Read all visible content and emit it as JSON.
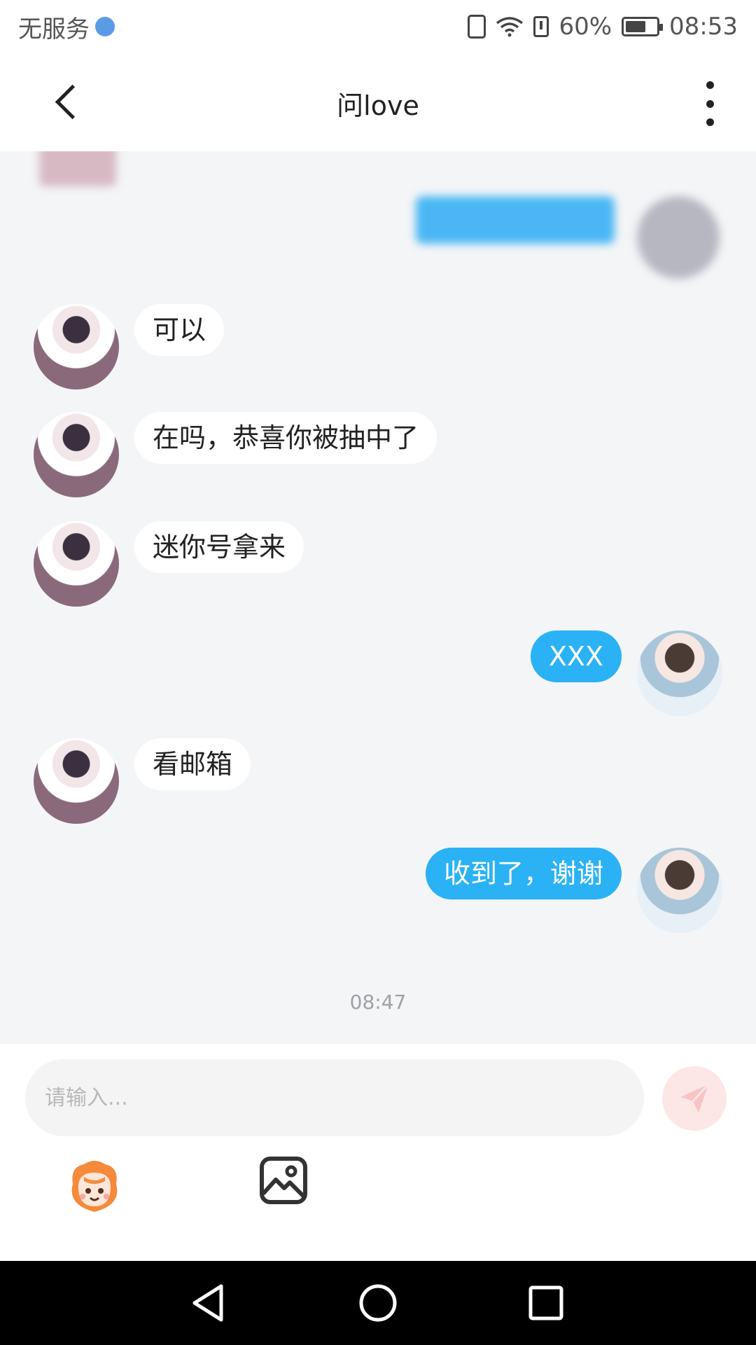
{
  "status_bar": {
    "carrier": "无服务",
    "battery": "60%",
    "time": "08:53"
  },
  "header": {
    "title": "问love"
  },
  "messages": [
    {
      "side": "in",
      "text": "可以"
    },
    {
      "side": "in",
      "text": "在吗，恭喜你被抽中了"
    },
    {
      "side": "in",
      "text": "迷你号拿来"
    },
    {
      "side": "out",
      "text": "XXX"
    },
    {
      "side": "in",
      "text": "看邮箱"
    },
    {
      "side": "out",
      "text": "收到了，谢谢"
    }
  ],
  "timestamp": "08:47",
  "input": {
    "placeholder": "请输入..."
  },
  "colors": {
    "outgoing_bubble": "#2ab2f5",
    "incoming_bubble": "#ffffff",
    "chat_background": "#f4f5f7"
  },
  "icons": {
    "back": "chevron-left-icon",
    "more": "vertical-dots-icon",
    "send": "paper-plane-icon",
    "emoji": "mascot-emoji-icon",
    "image": "image-icon"
  }
}
